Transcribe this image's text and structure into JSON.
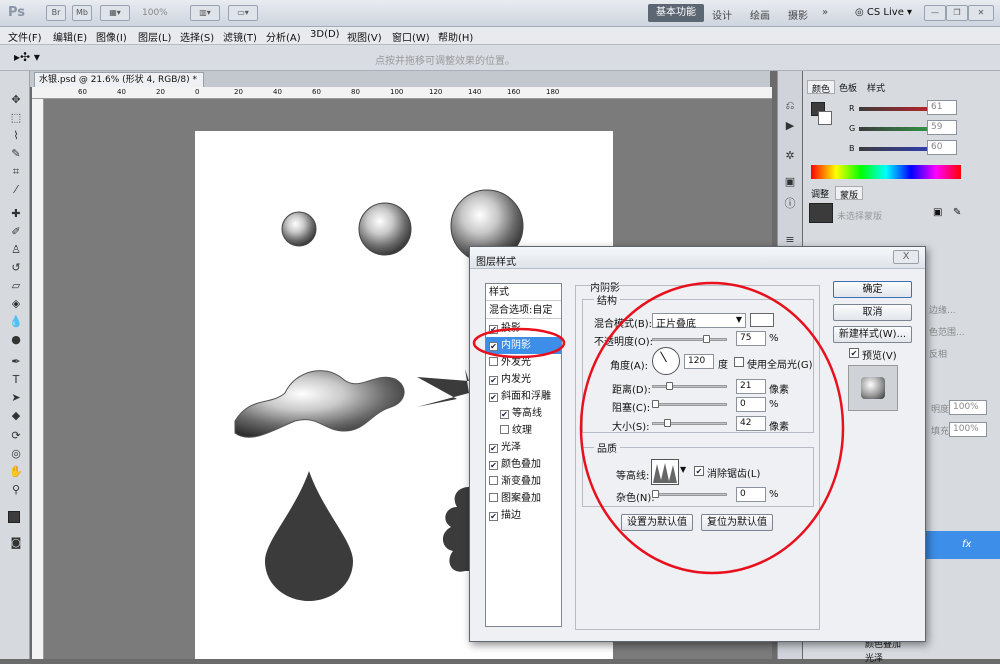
{
  "app": {
    "logo": "Ps",
    "zoom": "100%",
    "workspaces": [
      "基本功能",
      "设计",
      "绘画",
      "摄影",
      "»"
    ],
    "cs_live": "CS Live"
  },
  "menu": [
    "文件(F)",
    "编辑(E)",
    "图像(I)",
    "图层(L)",
    "选择(S)",
    "滤镜(T)",
    "分析(A)",
    "3D(D)",
    "视图(V)",
    "窗口(W)",
    "帮助(H)"
  ],
  "options_bar": {
    "hint": "点按并拖移可调整效果的位置。"
  },
  "document": {
    "tab_title": "水银.psd @ 21.6% (形状 4, RGB/8) *",
    "ruler_ticks": [
      "60",
      "40",
      "20",
      "0",
      "20",
      "40",
      "60",
      "80",
      "100",
      "120",
      "140",
      "160",
      "180"
    ]
  },
  "color_panel": {
    "tabs": [
      "颜色",
      "色板",
      "样式"
    ],
    "r_label": "R",
    "r_value": "61",
    "g_label": "G",
    "g_value": "59",
    "b_label": "B",
    "b_value": "60"
  },
  "adjust_panel": {
    "tabs": [
      "调整",
      "蒙版"
    ],
    "hint": "未选择蒙版",
    "fragments": [
      "边缘...",
      "色范围...",
      "反相"
    ]
  },
  "layers_panel": {
    "opacity_label": "明度:",
    "opacity_value": "100%",
    "fill_label": "填充:",
    "fill_value": "100%",
    "fx": "fx",
    "effects": [
      "颜色叠加",
      "光泽"
    ]
  },
  "dialog": {
    "title": "图层样式",
    "close": "X",
    "list_header": "样式",
    "blend_options": "混合选项:自定",
    "styles": [
      {
        "label": "投影",
        "checked": true,
        "indent": false
      },
      {
        "label": "内阴影",
        "checked": true,
        "indent": false,
        "selected": true
      },
      {
        "label": "外发光",
        "checked": false,
        "indent": false
      },
      {
        "label": "内发光",
        "checked": true,
        "indent": false
      },
      {
        "label": "斜面和浮雕",
        "checked": true,
        "indent": false
      },
      {
        "label": "等高线",
        "checked": true,
        "indent": true
      },
      {
        "label": "纹理",
        "checked": false,
        "indent": true
      },
      {
        "label": "光泽",
        "checked": true,
        "indent": false
      },
      {
        "label": "颜色叠加",
        "checked": true,
        "indent": false
      },
      {
        "label": "渐变叠加",
        "checked": false,
        "indent": false
      },
      {
        "label": "图案叠加",
        "checked": false,
        "indent": false
      },
      {
        "label": "描边",
        "checked": true,
        "indent": false
      }
    ],
    "section_title": "内阴影",
    "structure": {
      "title": "结构",
      "blend_mode_label": "混合模式(B):",
      "blend_mode_value": "正片叠底",
      "opacity_label": "不透明度(O):",
      "opacity_value": "75",
      "opacity_pct": 75,
      "angle_label": "角度(A):",
      "angle_value": "120",
      "angle_unit": "度",
      "global_light_label": "使用全局光(G)",
      "distance_label": "距离(D):",
      "distance_value": "21",
      "distance_pct": 21,
      "choke_label": "阻塞(C):",
      "choke_value": "0",
      "choke_pct": 0,
      "size_label": "大小(S):",
      "size_value": "42",
      "size_pct": 17,
      "px_unit": "像素",
      "percent_unit": "%"
    },
    "quality": {
      "title": "品质",
      "contour_label": "等高线:",
      "antialias_label": "消除锯齿(L)",
      "noise_label": "杂色(N):",
      "noise_value": "0",
      "noise_pct": 0,
      "percent_unit": "%"
    },
    "buttons": {
      "set_default": "设置为默认值",
      "reset_default": "复位为默认值",
      "ok": "确定",
      "cancel": "取消",
      "new_style": "新建样式(W)...",
      "preview": "预览(V)"
    }
  },
  "colors": {
    "accent": "#e8101c",
    "selection": "#3d8ee8",
    "shape": "#3b3b3b"
  }
}
